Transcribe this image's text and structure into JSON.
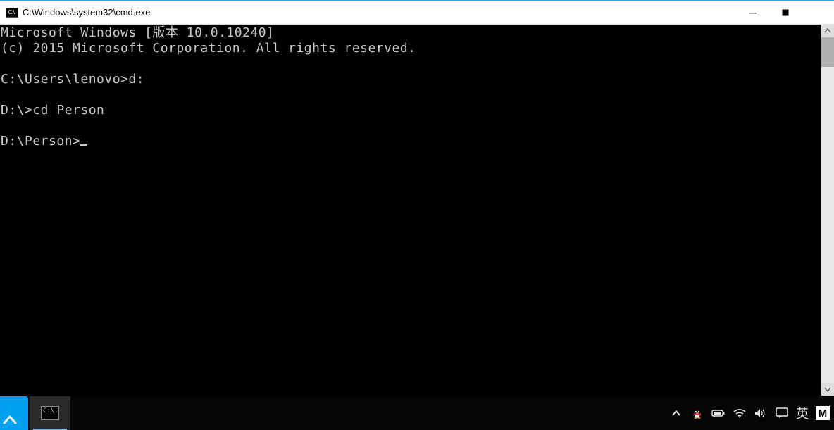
{
  "window": {
    "title": "C:\\Windows\\system32\\cmd.exe",
    "icon_label": "C:\\."
  },
  "console": {
    "lines": [
      "Microsoft Windows [版本 10.0.10240]",
      "(c) 2015 Microsoft Corporation. All rights reserved.",
      "",
      "C:\\Users\\lenovo>d:",
      "",
      "D:\\>cd Person",
      "",
      "D:\\Person>"
    ],
    "current_prompt": "D:\\Person>"
  },
  "taskbar": {
    "cmd_tile_text": "C:\\.",
    "ime_label": "英",
    "m_label": "M"
  }
}
